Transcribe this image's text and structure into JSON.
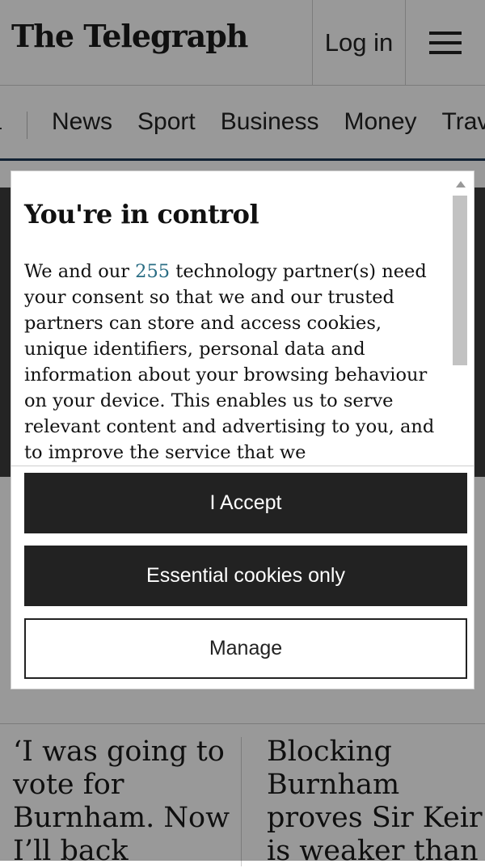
{
  "header": {
    "logo": "The Telegraph",
    "login_label": "Log in",
    "menu_icon": "hamburger-menu-icon"
  },
  "nav": {
    "items": [
      "News",
      "Sport",
      "Business",
      "Money",
      "Trav"
    ]
  },
  "articles": [
    {
      "headline": "‘I was going to vote for Burnham. Now I’ll back"
    },
    {
      "headline": "Blocking Burnham proves Sir Keir is weaker than"
    }
  ],
  "consent": {
    "title": "You're in control",
    "body_prefix": "We and our ",
    "partner_count": "255",
    "body_suffix": " technology partner(s) need your consent so that we and our trusted partners can store and access cookies, unique identifiers, personal data and information about your browsing behaviour on your device. This enables us to serve relevant content and advertising to you, and to improve the service that we",
    "accept_label": "I Accept",
    "essential_label": "Essential cookies only",
    "manage_label": "Manage"
  },
  "colors": {
    "button_dark": "#222222",
    "link": "#2a6d84",
    "nav_underline": "#1f3a55"
  }
}
